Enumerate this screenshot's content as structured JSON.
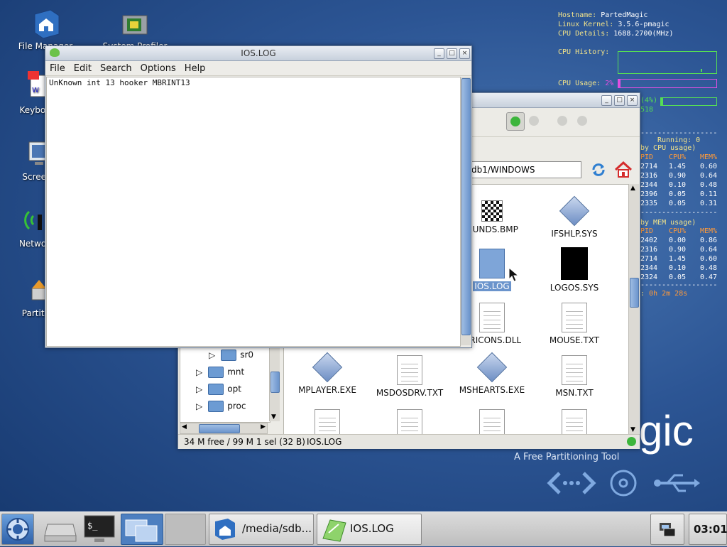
{
  "desktop": {
    "icons": [
      {
        "label": "File Manager"
      },
      {
        "label": "System Profiler"
      },
      {
        "label": "Keyboar"
      },
      {
        "label": "Screen"
      },
      {
        "label": "Network"
      },
      {
        "label": "Partitio"
      }
    ],
    "brand_text": "gic",
    "brand_tagline": "A Free Partitioning Tool"
  },
  "conky": {
    "hostname_label": "Hostname:",
    "hostname": "PartedMagic",
    "kernel_label": "Linux Kernel:",
    "kernel": "3.5.6-pmagic",
    "cpu_details_label": "CPU Details:",
    "cpu_details": "1688.2700(MHz)",
    "cpu_history_label": "CPU History:",
    "cpu_usage_label": "CPU Usage:",
    "cpu_usage": "2%",
    "mem_fragment_1": "(4%)",
    "mem_fragment_2": "518",
    "running": "Running: 0",
    "by_cpu": "by CPU usage)",
    "proc_headers": [
      "PID",
      "CPU%",
      "MEM%"
    ],
    "cpu_rows": [
      [
        "2714",
        "1.45",
        "0.60"
      ],
      [
        "2316",
        "0.90",
        "0.64"
      ],
      [
        "2344",
        "0.10",
        "0.48"
      ],
      [
        "2396",
        "0.05",
        "0.11"
      ],
      [
        "2335",
        "0.05",
        "0.31"
      ]
    ],
    "by_mem": "by MEM usage)",
    "mem_rows": [
      [
        "2402",
        "0.00",
        "0.86"
      ],
      [
        "2316",
        "0.90",
        "0.64"
      ],
      [
        "2714",
        "1.45",
        "0.60"
      ],
      [
        "2344",
        "0.10",
        "0.48"
      ],
      [
        "2324",
        "0.05",
        "0.47"
      ]
    ],
    "uptime_prefix": ":",
    "uptime": "0h 2m 28s",
    "cpu_usage_level": 0.02,
    "mem_usage_level": 0.04
  },
  "filemanager": {
    "path": "db1/WINDOWS",
    "files": [
      {
        "name": "OUNDS.BMP"
      },
      {
        "name": "IFSHLP.SYS"
      },
      {
        "name": "IOS.LOG"
      },
      {
        "name": "LOGOS.SYS"
      },
      {
        "name": "ORICONS.DLL"
      },
      {
        "name": "MOUSE.TXT"
      },
      {
        "name": "MPLAYER.EXE"
      },
      {
        "name": "MSDOSDRV.TXT"
      },
      {
        "name": "MSHEARTS.EXE"
      },
      {
        "name": "MSN.TXT"
      }
    ],
    "tree": [
      {
        "label": "sr0"
      },
      {
        "label": "mnt"
      },
      {
        "label": "opt"
      },
      {
        "label": "proc"
      }
    ],
    "status": {
      "free": "34 M free / 99 M",
      "selection": "1 sel (32 B)",
      "file": "IOS.LOG"
    }
  },
  "editor": {
    "title": "IOS.LOG",
    "menu": [
      "File",
      "Edit",
      "Search",
      "Options",
      "Help"
    ],
    "content": "UnKnown int 13 hooker MBRINT13"
  },
  "taskbar": {
    "task_filemanager": "/media/sdb...",
    "task_editor": "IOS.LOG",
    "clock": "03:01"
  }
}
